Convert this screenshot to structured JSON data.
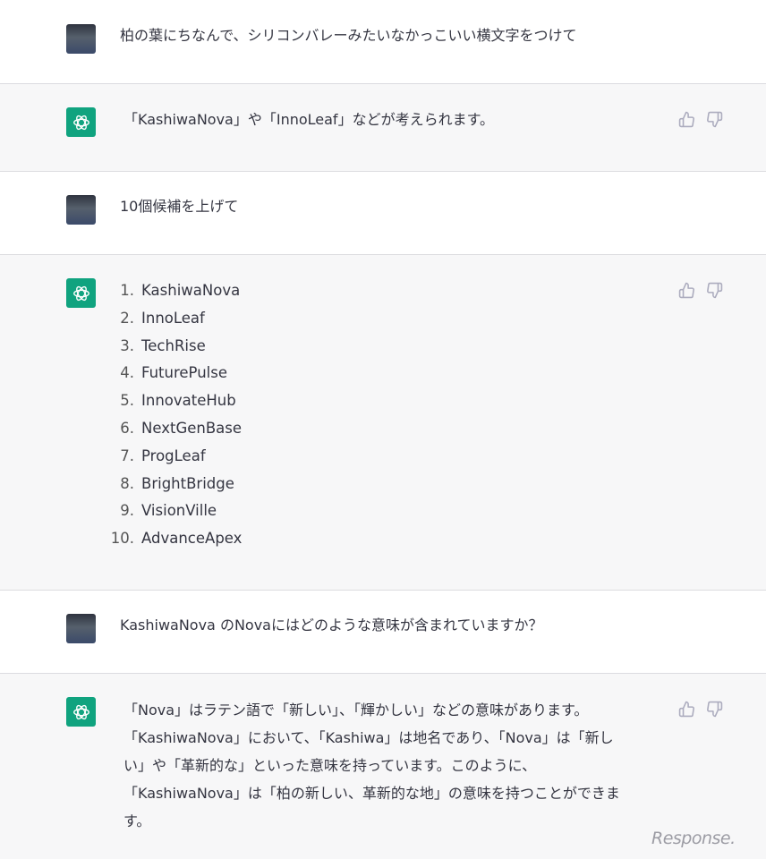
{
  "conversation": [
    {
      "role": "user",
      "text": "柏の葉にちなんで、シリコンバレーみたいなかっこいい横文字をつけて"
    },
    {
      "role": "assistant",
      "text": "「KashiwaNova」や「InnoLeaf」などが考えられます。"
    },
    {
      "role": "user",
      "text": "10個候補を上げて"
    },
    {
      "role": "assistant",
      "list": [
        {
          "num": "1.",
          "text": "KashiwaNova"
        },
        {
          "num": "2.",
          "text": "InnoLeaf"
        },
        {
          "num": "3.",
          "text": "TechRise"
        },
        {
          "num": "4.",
          "text": "FuturePulse"
        },
        {
          "num": "5.",
          "text": "InnovateHub"
        },
        {
          "num": "6.",
          "text": "NextGenBase"
        },
        {
          "num": "7.",
          "text": "ProgLeaf"
        },
        {
          "num": "8.",
          "text": "BrightBridge"
        },
        {
          "num": "9.",
          "text": "VisionVille"
        },
        {
          "num": "10.",
          "text": "AdvanceApex"
        }
      ]
    },
    {
      "role": "user",
      "text": "KashiwaNova のNovaにはどのような意味が含まれていますか？"
    },
    {
      "role": "assistant",
      "lines": [
        "「Nova」はラテン語で「新しい」、「輝かしい」などの意味があります。",
        "「KashiwaNova」において、「Kashiwa」は地名であり、「Nova」は「新し",
        "い」や「革新的な」といった意味を持っています。このように、",
        "「KashiwaNova」は「柏の新しい、革新的な地」の意味を持つことができま",
        "す。"
      ]
    }
  ],
  "icons": {
    "assistant_avatar": "openai-logo-icon",
    "thumbs_up": "thumbs-up-icon",
    "thumbs_down": "thumbs-down-icon"
  },
  "colors": {
    "assistant_accent": "#10a37f",
    "assistant_bg": "#f7f7f8",
    "text": "#343541"
  },
  "watermark": "Response."
}
